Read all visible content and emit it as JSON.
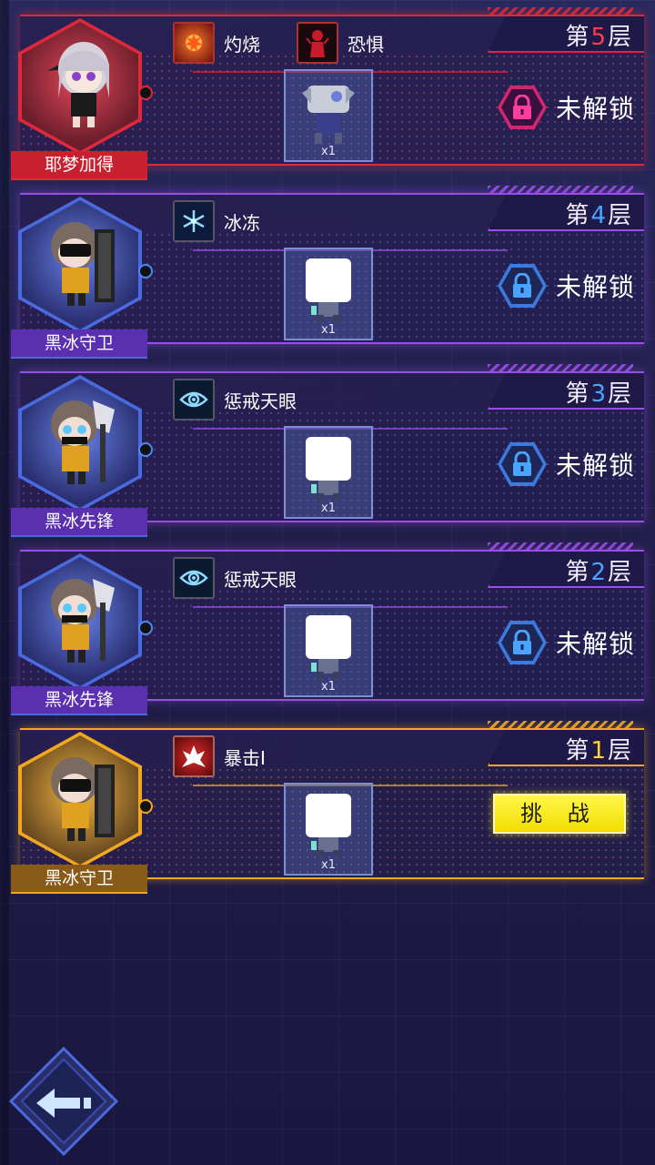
{
  "floors": [
    {
      "level_prefix": "第",
      "level_num": "5",
      "level_suffix": "层",
      "boss_name": "耶梦加得",
      "buffs": [
        {
          "icon": "burn-icon",
          "label": "灼烧"
        },
        {
          "icon": "fear-icon",
          "label": "恐惧"
        }
      ],
      "reward_qty": "x1",
      "status": "locked",
      "status_label": "未解锁",
      "theme": "red"
    },
    {
      "level_prefix": "第",
      "level_num": "4",
      "level_suffix": "层",
      "boss_name": "黑冰守卫",
      "buffs": [
        {
          "icon": "freeze-icon",
          "label": "冰冻"
        }
      ],
      "reward_qty": "x1",
      "status": "locked",
      "status_label": "未解锁",
      "theme": "purple"
    },
    {
      "level_prefix": "第",
      "level_num": "3",
      "level_suffix": "层",
      "boss_name": "黑冰先锋",
      "buffs": [
        {
          "icon": "eye-icon",
          "label": "惩戒天眼"
        }
      ],
      "reward_qty": "x1",
      "status": "locked",
      "status_label": "未解锁",
      "theme": "purple"
    },
    {
      "level_prefix": "第",
      "level_num": "2",
      "level_suffix": "层",
      "boss_name": "黑冰先锋",
      "buffs": [
        {
          "icon": "eye-icon",
          "label": "惩戒天眼"
        }
      ],
      "reward_qty": "x1",
      "status": "locked",
      "status_label": "未解锁",
      "theme": "purple"
    },
    {
      "level_prefix": "第",
      "level_num": "1",
      "level_suffix": "层",
      "boss_name": "黑冰守卫",
      "buffs": [
        {
          "icon": "crit-icon",
          "label": "暴击Ⅰ"
        }
      ],
      "reward_qty": "x1",
      "status": "available",
      "status_label": "挑 战",
      "theme": "gold"
    }
  ],
  "colors": {
    "red": "#e0283c",
    "purple": "#9a4de8",
    "gold": "#f0a820",
    "num_red": "#ff3b4e",
    "num_blue": "#4aa3ff",
    "num_gold": "#ffd23a",
    "challenge": "#f6e400"
  },
  "back_button": {
    "icon": "back-arrow-icon"
  }
}
